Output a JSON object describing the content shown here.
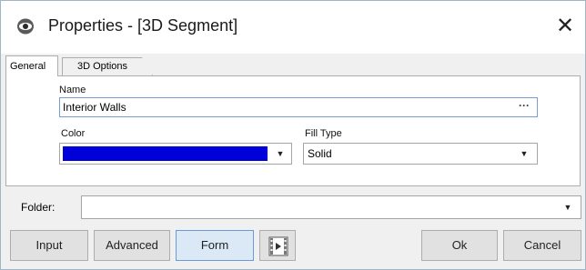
{
  "window": {
    "title": "Properties - [3D Segment]",
    "app_icon": "app-eye-icon",
    "close_glyph": "✕"
  },
  "tabs": [
    {
      "label": "General",
      "active": true
    },
    {
      "label": "3D Options",
      "active": false
    }
  ],
  "general": {
    "name_label": "Name",
    "name_value": "Interior Walls",
    "ellipsis_label": "···",
    "color_label": "Color",
    "color_value": "#0000d8",
    "fill_type_label": "Fill Type",
    "fill_type_value": "Solid"
  },
  "folder": {
    "label": "Folder:",
    "value": ""
  },
  "buttons": {
    "input": "Input",
    "advanced": "Advanced",
    "form": "Form",
    "media_icon": "media-play-icon",
    "ok": "Ok",
    "cancel": "Cancel"
  },
  "icons": {
    "dropdown": "▼"
  }
}
